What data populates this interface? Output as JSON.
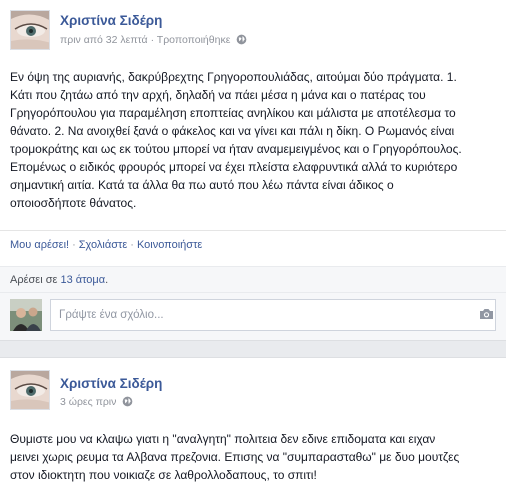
{
  "post1": {
    "author": "Χριστίνα Σιδέρη",
    "time": "πριν από 32 λεπτά",
    "edited": "Τροποποιήθηκε",
    "text_lines": [
      "Εν όψη της αυριανής, δακρύβρεχτης Γρηγοροπουλιάδας, αιτούμαι δύο πράγματα. 1.",
      "Κάτι που ζητάω από την αρχή, δηλαδή να πάει μέσα η μάνα και ο πατέρας του",
      "Γρηγορόπουλου για παραμέληση εποπτείας ανηλίκου και μάλιστα με αποτέλεσμα το",
      "θάνατο. 2. Να ανοιχθεί ξανά ο φάκελος και να γίνει και πάλι η δίκη. Ο Ρωμανός είναι",
      "τρομοκράτης και ως εκ τούτου μπορεί να ήταν αναμεμειγμένος και ο Γρηγορόπουλος.",
      "Επομένως ο ειδικός φρουρός μπορεί να έχει πλείστα ελαφρυντικά αλλά το κυριότερο",
      "σημαντική αιτία. Κατά τα άλλα θα πω αυτό που λέω πάντα είναι άδικος ο",
      "οποιοσδήποτε θάνατος."
    ],
    "actions": {
      "like": "Μου αρέσει!",
      "comment": "Σχολιάστε",
      "share": "Κοινοποιήστε"
    },
    "likes_prefix": "Αρέσει σε ",
    "likes_link": "13 άτομα",
    "likes_suffix": ".",
    "comment_placeholder": "Γράψτε ένα σχόλιο..."
  },
  "post2": {
    "author": "Χριστίνα Σιδέρη",
    "time": "3 ώρες πριν",
    "text_lines": [
      "Θυμιστε μου να κλαψω γιατι η \"αναλγητη\" πολιτεια δεν εδινε επιδοματα και ειχαν",
      "μεινει χωρις ρευμα τα Αλβανα πρεζονια. Επισης να \"συμπαρασταθω\" με δυο μουτζες",
      "στον ιδιοκτητη που νοικιαζε σε λαθρολλοδαπους, το σπιτι!"
    ]
  },
  "colors": {
    "link": "#3b5998",
    "meta": "#90949c",
    "text": "#141823",
    "background_gap": "#e9ebee"
  },
  "icons": [
    "globe-icon",
    "camera-icon"
  ]
}
